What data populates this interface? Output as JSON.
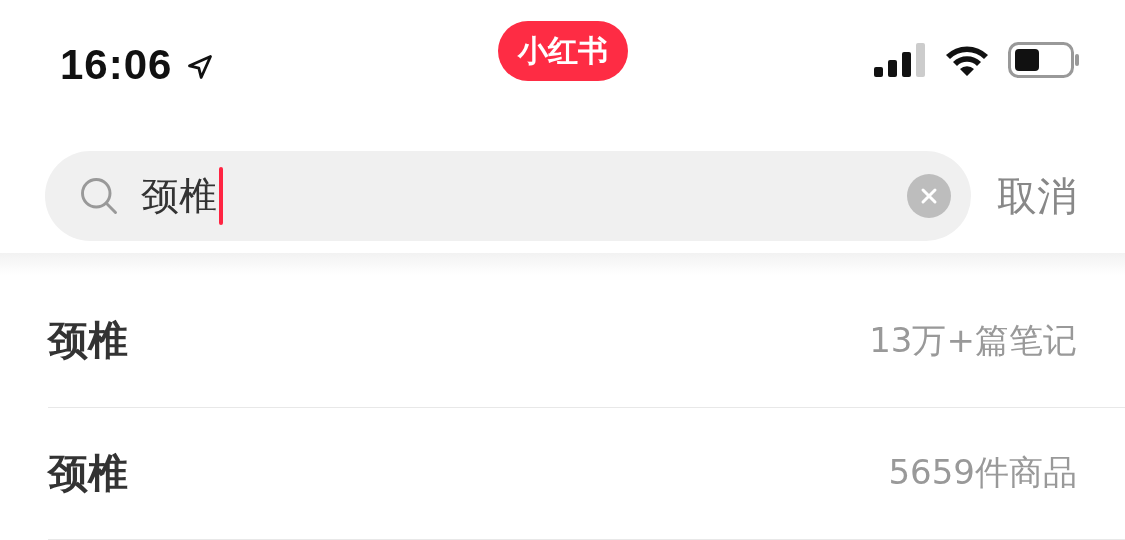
{
  "status_bar": {
    "time": "16:06",
    "app_badge": "小红书"
  },
  "search": {
    "value": "颈椎",
    "cancel": "取消"
  },
  "suggestions": [
    {
      "text": "颈椎",
      "count": "13万+篇笔记"
    },
    {
      "text": "颈椎",
      "count": "5659件商品"
    }
  ]
}
